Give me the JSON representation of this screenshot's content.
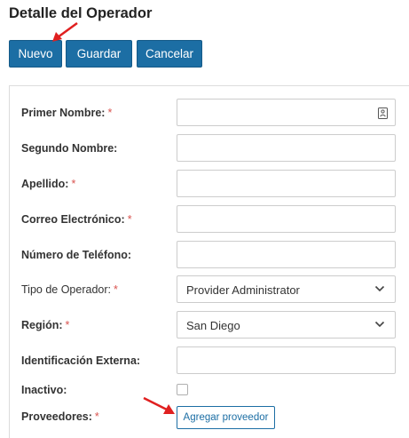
{
  "page": {
    "title": "Detalle del Operador"
  },
  "toolbar": {
    "new_label": "Nuevo",
    "save_label": "Guardar",
    "cancel_label": "Cancelar"
  },
  "form": {
    "required_marker": "*",
    "first_name": {
      "label": "Primer Nombre:",
      "value": "",
      "required": true
    },
    "middle_name": {
      "label": "Segundo Nombre:",
      "value": "",
      "required": false
    },
    "last_name": {
      "label": "Apellido:",
      "value": "",
      "required": true
    },
    "email": {
      "label": "Correo Electrónico:",
      "value": "",
      "required": true
    },
    "phone": {
      "label": "Número de Teléfono:",
      "value": "",
      "required": false
    },
    "operator_type": {
      "label": "Tipo de Operador:",
      "selected": "Provider Administrator",
      "required": true
    },
    "region": {
      "label": "Región:",
      "selected": "San Diego",
      "required": true
    },
    "external_id": {
      "label": "Identificación Externa:",
      "value": "",
      "required": false
    },
    "inactive": {
      "label": "Inactivo:",
      "checked": false
    },
    "providers": {
      "label": "Proveedores:",
      "required": true,
      "add_label": "Agregar proveedor"
    }
  },
  "annotations": {
    "arrow_color": "#e02020"
  },
  "icons": {
    "contact_card": "contact-card-icon",
    "chevron": "chevron-down-icon"
  }
}
